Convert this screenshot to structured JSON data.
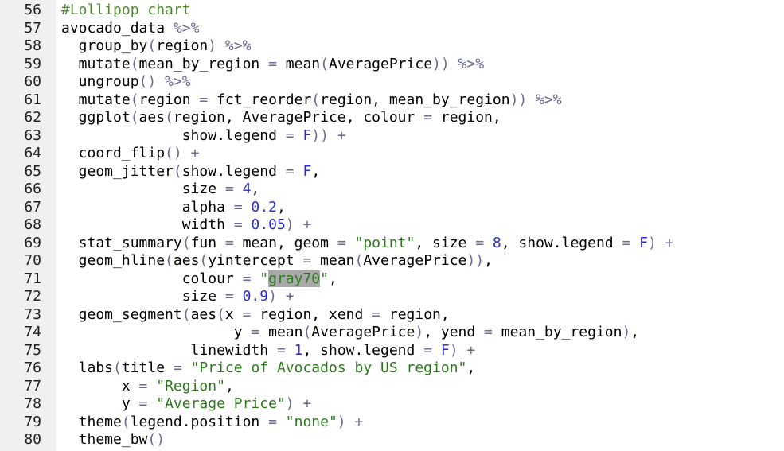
{
  "editor": {
    "colors": {
      "comment": "#4d8a2e",
      "operator": "#6a6a90",
      "number": "#2a2ad0",
      "string": "#2a7a1a",
      "text": "#000000",
      "selection": "#a9a9a9",
      "gutter_bg": "#f0f0f0"
    },
    "lines": [
      {
        "num": "56",
        "tokens": [
          {
            "t": "#Lollipop chart",
            "c": "comment"
          }
        ]
      },
      {
        "num": "57",
        "tokens": [
          {
            "t": "avocado_data ",
            "c": "text"
          },
          {
            "t": "%>%",
            "c": "op"
          }
        ]
      },
      {
        "num": "58",
        "tokens": [
          {
            "t": "  group_by",
            "c": "text"
          },
          {
            "t": "(",
            "c": "paren"
          },
          {
            "t": "region",
            "c": "text"
          },
          {
            "t": ")",
            "c": "paren"
          },
          {
            "t": " %>%",
            "c": "op"
          }
        ]
      },
      {
        "num": "59",
        "tokens": [
          {
            "t": "  mutate",
            "c": "text"
          },
          {
            "t": "(",
            "c": "paren"
          },
          {
            "t": "mean_by_region ",
            "c": "text"
          },
          {
            "t": "=",
            "c": "op"
          },
          {
            "t": " mean",
            "c": "text"
          },
          {
            "t": "(",
            "c": "paren"
          },
          {
            "t": "AveragePrice",
            "c": "text"
          },
          {
            "t": "))",
            "c": "paren"
          },
          {
            "t": " %>%",
            "c": "op"
          }
        ]
      },
      {
        "num": "60",
        "tokens": [
          {
            "t": "  ungroup",
            "c": "text"
          },
          {
            "t": "()",
            "c": "paren"
          },
          {
            "t": " %>%",
            "c": "op"
          }
        ]
      },
      {
        "num": "61",
        "tokens": [
          {
            "t": "  mutate",
            "c": "text"
          },
          {
            "t": "(",
            "c": "paren"
          },
          {
            "t": "region ",
            "c": "text"
          },
          {
            "t": "=",
            "c": "op"
          },
          {
            "t": " fct_reorder",
            "c": "text"
          },
          {
            "t": "(",
            "c": "paren"
          },
          {
            "t": "region, mean_by_region",
            "c": "text"
          },
          {
            "t": "))",
            "c": "paren"
          },
          {
            "t": " %>%",
            "c": "op"
          }
        ]
      },
      {
        "num": "62",
        "tokens": [
          {
            "t": "  ggplot",
            "c": "text"
          },
          {
            "t": "(",
            "c": "paren"
          },
          {
            "t": "aes",
            "c": "text"
          },
          {
            "t": "(",
            "c": "paren"
          },
          {
            "t": "region, AveragePrice, colour ",
            "c": "text"
          },
          {
            "t": "=",
            "c": "op"
          },
          {
            "t": " region,",
            "c": "text"
          }
        ]
      },
      {
        "num": "63",
        "tokens": [
          {
            "t": "              show.legend ",
            "c": "text"
          },
          {
            "t": "=",
            "c": "op"
          },
          {
            "t": " F",
            "c": "num"
          },
          {
            "t": "))",
            "c": "paren"
          },
          {
            "t": " +",
            "c": "op"
          }
        ]
      },
      {
        "num": "64",
        "tokens": [
          {
            "t": "  coord_flip",
            "c": "text"
          },
          {
            "t": "()",
            "c": "paren"
          },
          {
            "t": " +",
            "c": "op"
          }
        ]
      },
      {
        "num": "65",
        "tokens": [
          {
            "t": "  geom_jitter",
            "c": "text"
          },
          {
            "t": "(",
            "c": "paren"
          },
          {
            "t": "show.legend ",
            "c": "text"
          },
          {
            "t": "=",
            "c": "op"
          },
          {
            "t": " F",
            "c": "num"
          },
          {
            "t": ",",
            "c": "text"
          }
        ]
      },
      {
        "num": "66",
        "tokens": [
          {
            "t": "              size ",
            "c": "text"
          },
          {
            "t": "=",
            "c": "op"
          },
          {
            "t": " 4",
            "c": "num"
          },
          {
            "t": ",",
            "c": "text"
          }
        ]
      },
      {
        "num": "67",
        "tokens": [
          {
            "t": "              alpha ",
            "c": "text"
          },
          {
            "t": "=",
            "c": "op"
          },
          {
            "t": " 0.2",
            "c": "num"
          },
          {
            "t": ",",
            "c": "text"
          }
        ]
      },
      {
        "num": "68",
        "tokens": [
          {
            "t": "              width ",
            "c": "text"
          },
          {
            "t": "=",
            "c": "op"
          },
          {
            "t": " 0.05",
            "c": "num"
          },
          {
            "t": ")",
            "c": "paren"
          },
          {
            "t": " +",
            "c": "op"
          }
        ]
      },
      {
        "num": "69",
        "tokens": [
          {
            "t": "  stat_summary",
            "c": "text"
          },
          {
            "t": "(",
            "c": "paren"
          },
          {
            "t": "fun ",
            "c": "text"
          },
          {
            "t": "=",
            "c": "op"
          },
          {
            "t": " mean, geom ",
            "c": "text"
          },
          {
            "t": "=",
            "c": "op"
          },
          {
            "t": " \"point\"",
            "c": "str"
          },
          {
            "t": ", size ",
            "c": "text"
          },
          {
            "t": "=",
            "c": "op"
          },
          {
            "t": " 8",
            "c": "num"
          },
          {
            "t": ", show.legend ",
            "c": "text"
          },
          {
            "t": "=",
            "c": "op"
          },
          {
            "t": " F",
            "c": "num"
          },
          {
            "t": ")",
            "c": "paren"
          },
          {
            "t": " +",
            "c": "op"
          }
        ]
      },
      {
        "num": "70",
        "tokens": [
          {
            "t": "  geom_hline",
            "c": "text"
          },
          {
            "t": "(",
            "c": "paren"
          },
          {
            "t": "aes",
            "c": "text"
          },
          {
            "t": "(",
            "c": "paren"
          },
          {
            "t": "yintercept ",
            "c": "text"
          },
          {
            "t": "=",
            "c": "op"
          },
          {
            "t": " mean",
            "c": "text"
          },
          {
            "t": "(",
            "c": "paren"
          },
          {
            "t": "AveragePrice",
            "c": "text"
          },
          {
            "t": "))",
            "c": "paren"
          },
          {
            "t": ",",
            "c": "text"
          }
        ]
      },
      {
        "num": "71",
        "tokens": [
          {
            "t": "              colour ",
            "c": "text"
          },
          {
            "t": "=",
            "c": "op"
          },
          {
            "t": " \"",
            "c": "str"
          },
          {
            "t": "gray70",
            "c": "str-sel"
          },
          {
            "t": "\"",
            "c": "str"
          },
          {
            "t": ",",
            "c": "text"
          }
        ]
      },
      {
        "num": "72",
        "tokens": [
          {
            "t": "              size ",
            "c": "text"
          },
          {
            "t": "=",
            "c": "op"
          },
          {
            "t": " 0.9",
            "c": "num"
          },
          {
            "t": ")",
            "c": "paren"
          },
          {
            "t": " +",
            "c": "op"
          }
        ]
      },
      {
        "num": "73",
        "tokens": [
          {
            "t": "  geom_segment",
            "c": "text"
          },
          {
            "t": "(",
            "c": "paren"
          },
          {
            "t": "aes",
            "c": "text"
          },
          {
            "t": "(",
            "c": "paren"
          },
          {
            "t": "x ",
            "c": "text"
          },
          {
            "t": "=",
            "c": "op"
          },
          {
            "t": " region, xend ",
            "c": "text"
          },
          {
            "t": "=",
            "c": "op"
          },
          {
            "t": " region,",
            "c": "text"
          }
        ]
      },
      {
        "num": "74",
        "tokens": [
          {
            "t": "                    y ",
            "c": "text"
          },
          {
            "t": "=",
            "c": "op"
          },
          {
            "t": " mean",
            "c": "text"
          },
          {
            "t": "(",
            "c": "paren"
          },
          {
            "t": "AveragePrice",
            "c": "text"
          },
          {
            "t": ")",
            "c": "paren"
          },
          {
            "t": ", yend ",
            "c": "text"
          },
          {
            "t": "=",
            "c": "op"
          },
          {
            "t": " mean_by_region",
            "c": "text"
          },
          {
            "t": ")",
            "c": "paren"
          },
          {
            "t": ",",
            "c": "text"
          }
        ]
      },
      {
        "num": "75",
        "tokens": [
          {
            "t": "               linewidth ",
            "c": "text"
          },
          {
            "t": "=",
            "c": "op"
          },
          {
            "t": " 1",
            "c": "num"
          },
          {
            "t": ", show.legend ",
            "c": "text"
          },
          {
            "t": "=",
            "c": "op"
          },
          {
            "t": " F",
            "c": "num"
          },
          {
            "t": ")",
            "c": "paren"
          },
          {
            "t": " +",
            "c": "op"
          }
        ]
      },
      {
        "num": "76",
        "tokens": [
          {
            "t": "  labs",
            "c": "text"
          },
          {
            "t": "(",
            "c": "paren"
          },
          {
            "t": "title ",
            "c": "text"
          },
          {
            "t": "=",
            "c": "op"
          },
          {
            "t": " \"Price of Avocados by US region\"",
            "c": "str"
          },
          {
            "t": ",",
            "c": "text"
          }
        ]
      },
      {
        "num": "77",
        "tokens": [
          {
            "t": "       x ",
            "c": "text"
          },
          {
            "t": "=",
            "c": "op"
          },
          {
            "t": " \"Region\"",
            "c": "str"
          },
          {
            "t": ",",
            "c": "text"
          }
        ]
      },
      {
        "num": "78",
        "tokens": [
          {
            "t": "       y ",
            "c": "text"
          },
          {
            "t": "=",
            "c": "op"
          },
          {
            "t": " \"Average Price\"",
            "c": "str"
          },
          {
            "t": ")",
            "c": "paren"
          },
          {
            "t": " +",
            "c": "op"
          }
        ]
      },
      {
        "num": "79",
        "tokens": [
          {
            "t": "  theme",
            "c": "text"
          },
          {
            "t": "(",
            "c": "paren"
          },
          {
            "t": "legend.position ",
            "c": "text"
          },
          {
            "t": "=",
            "c": "op"
          },
          {
            "t": " \"none\"",
            "c": "str"
          },
          {
            "t": ")",
            "c": "paren"
          },
          {
            "t": " +",
            "c": "op"
          }
        ]
      },
      {
        "num": "80",
        "tokens": [
          {
            "t": "  theme_bw",
            "c": "text"
          },
          {
            "t": "()",
            "c": "paren"
          }
        ]
      }
    ]
  }
}
